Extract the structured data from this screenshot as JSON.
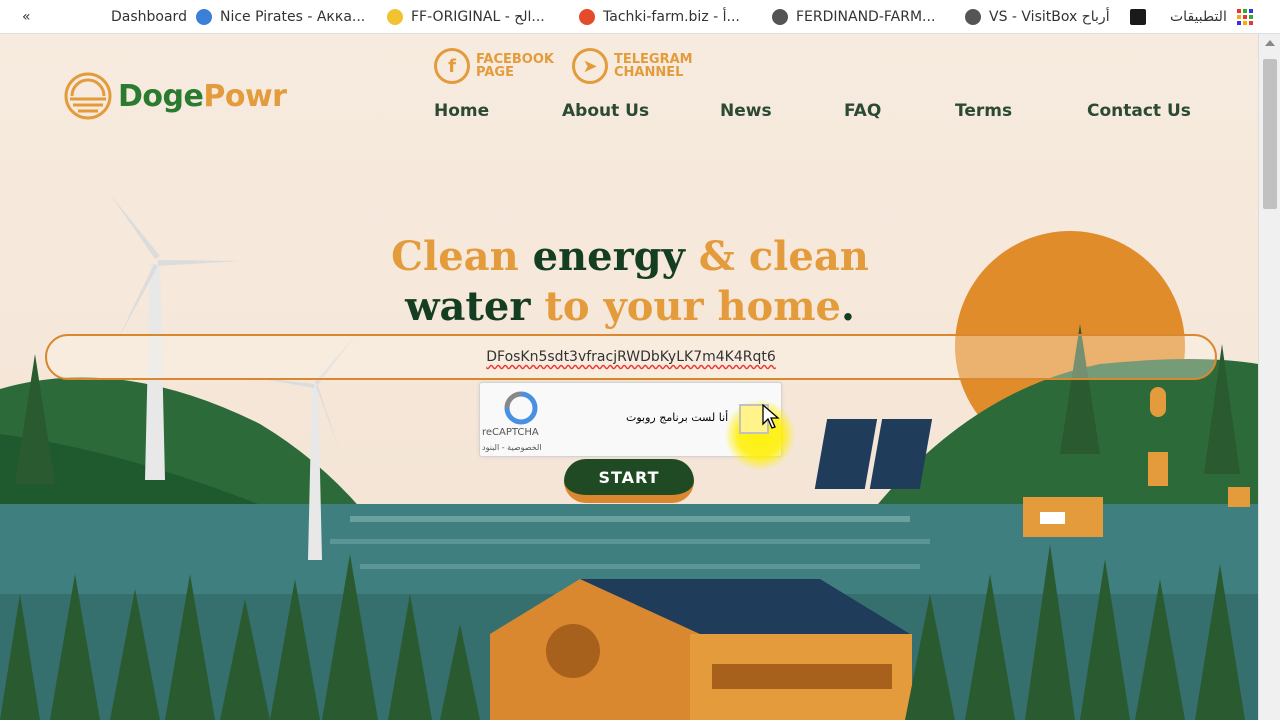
{
  "bookmarks": {
    "collapse": "«",
    "items": [
      {
        "label": "Dashboard"
      },
      {
        "label": "Nice Pirates - Аккa..."
      },
      {
        "label": "FF-ORIGINAL - الح..."
      },
      {
        "label": "Tachki-farm.biz - أ..."
      },
      {
        "label": "FERDINAND-FARM..."
      },
      {
        "label": "VS - VisitBox أرباح"
      },
      {
        "label": "التطبيقات"
      }
    ]
  },
  "logo": {
    "part1": "Doge",
    "part2": "Powr"
  },
  "social": {
    "facebook": {
      "line1": "FACEBOOK",
      "line2": "PAGE"
    },
    "telegram": {
      "line1": "TELEGRAM",
      "line2": "CHANNEL"
    }
  },
  "nav": {
    "home": "Home",
    "about": "About Us",
    "news": "News",
    "faq": "FAQ",
    "terms": "Terms",
    "contact": "Contact Us"
  },
  "hero": {
    "w1": "Clean",
    "w2": " energy",
    "w3": " & clean",
    "w4": "water",
    "w5": " to your home",
    "w6": "."
  },
  "address": {
    "value": "DFosKn5sdt3vfracjRWDbKyLK7m4K4Rqt6"
  },
  "captcha": {
    "label": "أنا لست برنامج روبوت",
    "brand": "reCAPTCHA",
    "privacy": "الخصوصية - البنود"
  },
  "start_button": "START",
  "colors": {
    "orange": "#e39b3b",
    "dark_green": "#143d22",
    "background": "#f6e9dc"
  }
}
